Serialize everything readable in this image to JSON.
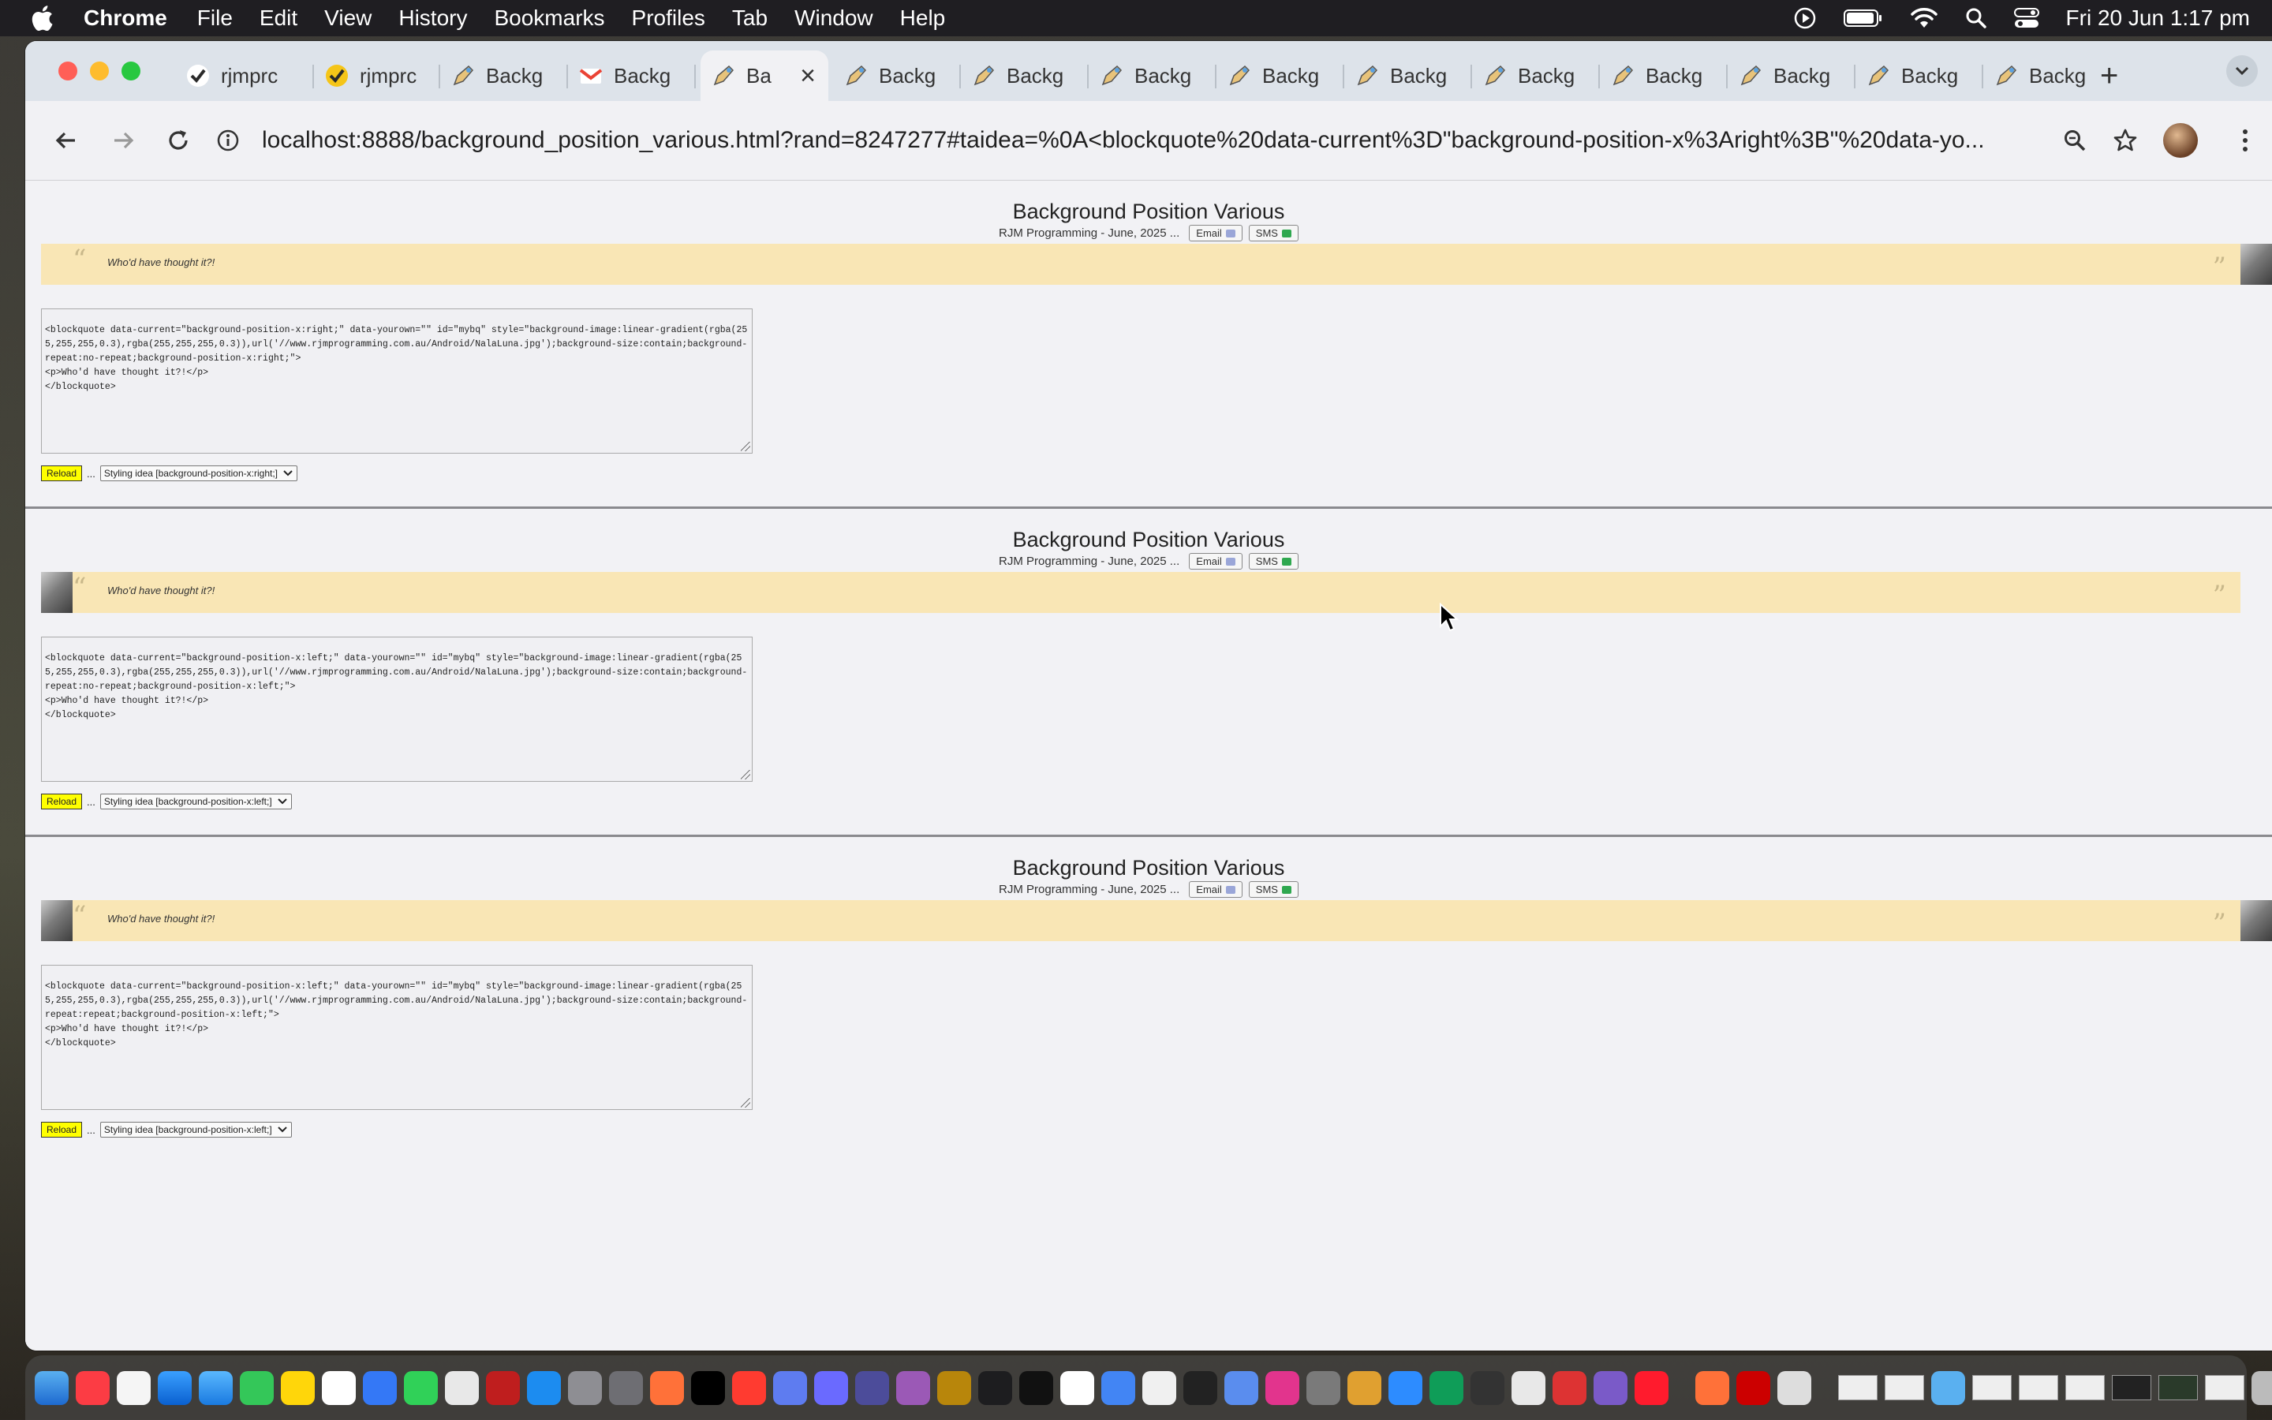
{
  "menubar": {
    "app_name": "Chrome",
    "items": [
      "File",
      "Edit",
      "View",
      "History",
      "Bookmarks",
      "Profiles",
      "Tab",
      "Window",
      "Help"
    ],
    "clock": "Fri 20 Jun  1:17 pm"
  },
  "tabs": [
    {
      "label": "rjmprc",
      "icon": "check-favicon",
      "active": false
    },
    {
      "label": "rjmprc",
      "icon": "check-favicon",
      "active": false
    },
    {
      "label": "Backg",
      "icon": "pen-favicon",
      "active": false
    },
    {
      "label": "Backg",
      "icon": "gmail-favicon",
      "active": false
    },
    {
      "label": "Ba",
      "icon": "pen-favicon",
      "active": true
    },
    {
      "label": "Backg",
      "icon": "pen-favicon",
      "active": false
    },
    {
      "label": "Backg",
      "icon": "pen-favicon",
      "active": false
    },
    {
      "label": "Backg",
      "icon": "pen-favicon",
      "active": false
    },
    {
      "label": "Backg",
      "icon": "pen-favicon",
      "active": false
    },
    {
      "label": "Backg",
      "icon": "pen-favicon",
      "active": false
    },
    {
      "label": "Backg",
      "icon": "pen-favicon",
      "active": false
    },
    {
      "label": "Backg",
      "icon": "pen-favicon",
      "active": false
    },
    {
      "label": "Backg",
      "icon": "pen-favicon",
      "active": false
    },
    {
      "label": "Backg",
      "icon": "pen-favicon",
      "active": false
    },
    {
      "label": "Backg",
      "icon": "pen-favicon",
      "active": false
    }
  ],
  "address": {
    "url": "localhost:8888/background_position_various.html?rand=8247277#taidea=%0A<blockquote%20data-current%3D\"background-position-x%3Aright%3B\"%20data-yo..."
  },
  "sections": [
    {
      "title": "Background Position Various",
      "byline": "RJM Programming - June, 2025 ...",
      "email_label": "Email",
      "sms_label": "SMS",
      "quote_text": "Who'd have thought it?!",
      "code": "<blockquote data-current=\"background-position-x:right;\" data-yourown=\"\" id=\"mybq\" style=\"background-image:linear-gradient(rgba(255,255,255,0.3),rgba(255,255,255,0.3)),url('//www.rjmprogramming.com.au/Android/NalaLuna.jpg');background-size:contain;background-repeat:no-repeat;background-position-x:right;\">\n<p>Who'd have thought it?!</p>\n</blockquote>",
      "reload_label": "Reload",
      "ellipsis": "...",
      "select_value": "Styling idea [background-position-x:right;]"
    },
    {
      "title": "Background Position Various",
      "byline": "RJM Programming - June, 2025 ...",
      "email_label": "Email",
      "sms_label": "SMS",
      "quote_text": "Who'd have thought it?!",
      "code": "<blockquote data-current=\"background-position-x:left;\" data-yourown=\"\" id=\"mybq\" style=\"background-image:linear-gradient(rgba(255,255,255,0.3),rgba(255,255,255,0.3)),url('//www.rjmprogramming.com.au/Android/NalaLuna.jpg');background-size:contain;background-repeat:no-repeat;background-position-x:left;\">\n<p>Who'd have thought it?!</p>\n</blockquote>",
      "reload_label": "Reload",
      "ellipsis": "...",
      "select_value": "Styling idea [background-position-x:left;]"
    },
    {
      "title": "Background Position Various",
      "byline": "RJM Programming - June, 2025 ...",
      "email_label": "Email",
      "sms_label": "SMS",
      "quote_text": "Who'd have thought it?!",
      "code": "<blockquote data-current=\"background-position-x:left;\" data-yourown=\"\" id=\"mybq\" style=\"background-image:linear-gradient(rgba(255,255,255,0.3),rgba(255,255,255,0.3)),url('//www.rjmprogramming.com.au/Android/NalaLuna.jpg');background-size:contain;background-repeat:repeat;background-position-x:left;\">\n<p>Who'd have thought it?!</p>\n</blockquote>",
      "reload_label": "Reload",
      "ellipsis": "...",
      "select_value": "Styling idea [background-position-x:left;]"
    }
  ],
  "colors": {
    "quote_band": "#f9e6b5",
    "reload_button": "#ffff00",
    "tabstrip": "#dde3ea"
  }
}
